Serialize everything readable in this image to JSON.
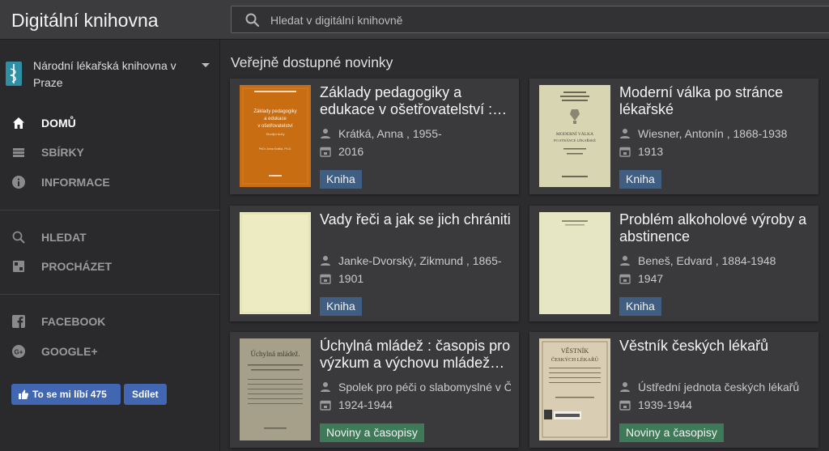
{
  "app": {
    "title": "Digitální knihovna"
  },
  "search": {
    "placeholder": "Hledat v digitální knihovně",
    "icon": "search-icon"
  },
  "sidebar": {
    "library": "Národní lékařská knihovna v Praze",
    "nav": [
      {
        "label": "DOMŮ",
        "icon": "home-icon",
        "active": true
      },
      {
        "label": "SBÍRKY",
        "icon": "collections-icon",
        "active": false
      },
      {
        "label": "INFORMACE",
        "icon": "info-icon",
        "active": false
      },
      {
        "label": "HLEDAT",
        "icon": "search-icon",
        "active": false
      },
      {
        "label": "PROCHÁZET",
        "icon": "browse-icon",
        "active": false
      },
      {
        "label": "FACEBOOK",
        "icon": "facebook-icon",
        "active": false
      },
      {
        "label": "GOOGLE+",
        "icon": "google-plus-icon",
        "active": false
      }
    ],
    "like_button": "To se mi líbí 475",
    "share_button": "Sdílet"
  },
  "main": {
    "section_title": "Veřejně dostupné novinky",
    "cards": [
      {
        "title": "Základy pedagogiky a edukace v ošetřovatelství : studijní text",
        "author": "Krátká, Anna , 1955-",
        "year": "2016",
        "type": "Kniha",
        "cover_lines": [
          "Základy pedagogiky",
          "a edukace",
          "v ošetřovatelství",
          "Studijní texty",
          "PhDr. Anna Krátká, Ph.D."
        ]
      },
      {
        "title": "Moderní válka po stránce lékařské",
        "author": "Wiesner, Antonín , 1868-1938",
        "year": "1913",
        "type": "Kniha",
        "cover_lines": [
          "MODERNÍ VÁLKA",
          "PO STRÁNCE LÉKAŘSKÉ"
        ]
      },
      {
        "title": "Vady řeči a jak se jich chrániti",
        "author": "Janke-Dvorský, Zikmund , 1865-",
        "year": "1901",
        "type": "Kniha"
      },
      {
        "title": "Problém alkoholové výroby a abstinence",
        "author": "Beneš, Edvard , 1884-1948",
        "year": "1947",
        "type": "Kniha"
      },
      {
        "title": "Úchylná mládež : časopis pro výzkum a výchovu mládeže úchylné",
        "author": "Spolek pro péči o slabomyslné v Čechách",
        "year": "1924-1944",
        "type": "Noviny a časopisy",
        "cover_lines": [
          "Úchylná mládež."
        ]
      },
      {
        "title": "Věstník českých lékařů",
        "author": "Ústřední jednota českých lékařů",
        "year": "1939-1944",
        "type": "Noviny a časopisy",
        "cover_lines": [
          "VĚSTNÍK",
          "ČESKÝCH LÉKAŘŮ"
        ]
      }
    ]
  },
  "colors": {
    "badge_book": "#3f5e82",
    "badge_periodical": "#3e7a57",
    "facebook": "#4267b2"
  }
}
